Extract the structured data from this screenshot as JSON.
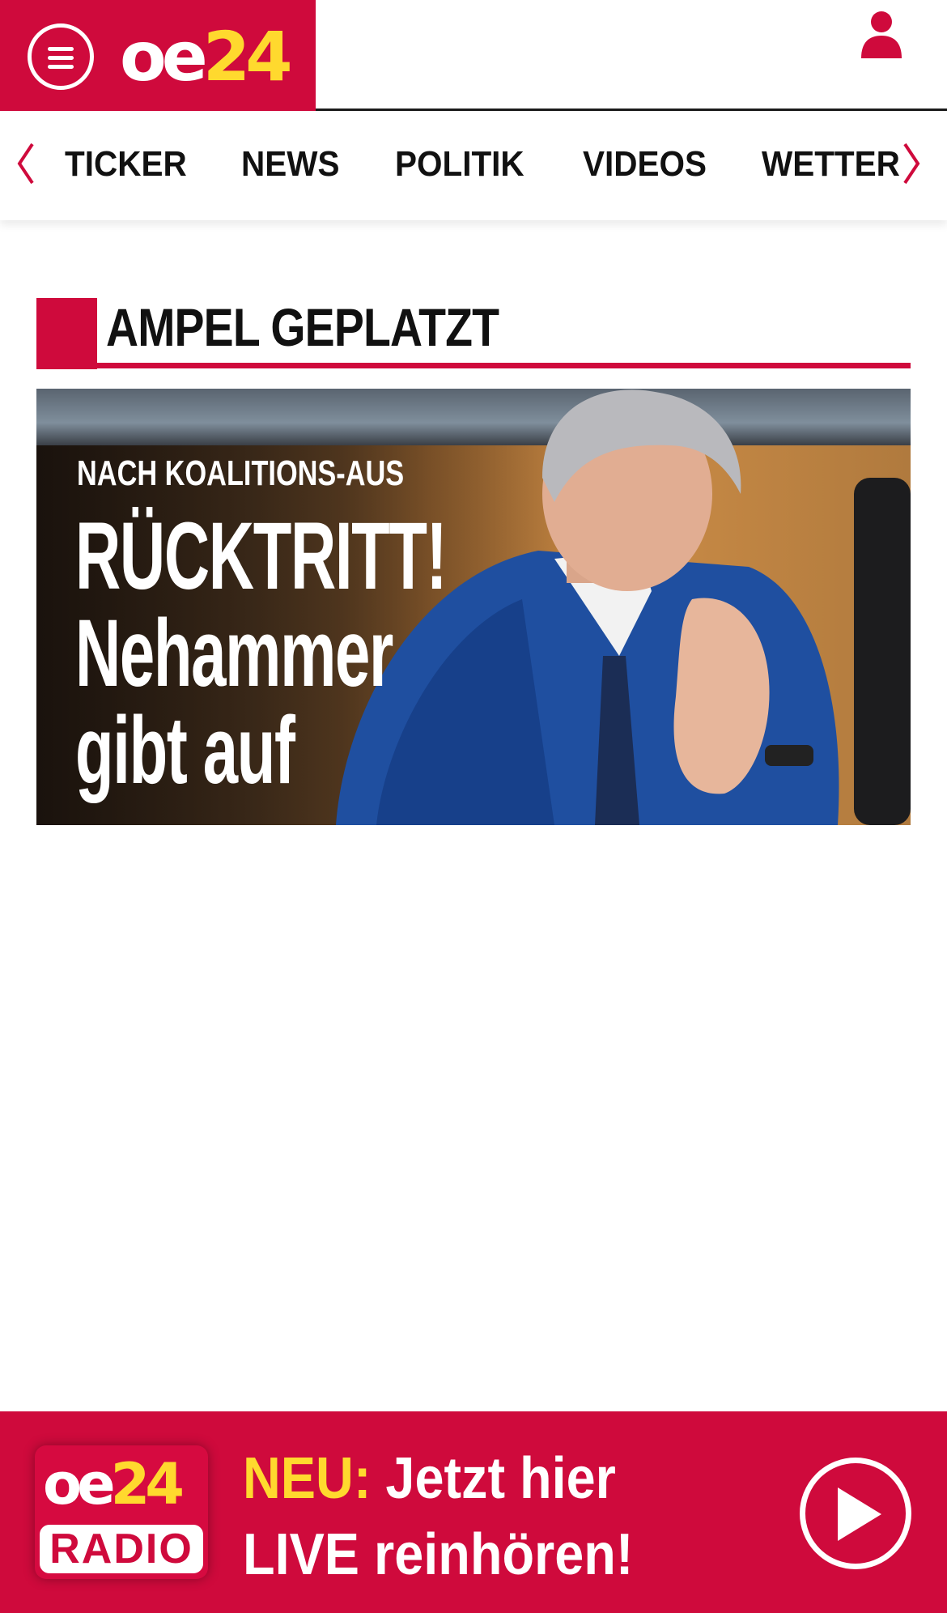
{
  "header": {
    "logo": {
      "part1": "oe",
      "part2": "24"
    },
    "menu_icon": "hamburger-menu-icon",
    "user_icon": "user-icon"
  },
  "nav": {
    "items": [
      "TICKER",
      "NEWS",
      "POLITIK",
      "VIDEOS",
      "WETTER"
    ],
    "prev_icon": "chevron-left-icon",
    "next_icon": "chevron-right-icon"
  },
  "section": {
    "title": "AMPEL GEPLATZT"
  },
  "hero": {
    "kicker": "NACH KOALITIONS-AUS",
    "line1": "RÜCKTRITT!",
    "line2": "Nehammer",
    "line3": "gibt auf"
  },
  "radio_banner": {
    "logo_top_part1": "oe",
    "logo_top_part2": "24",
    "logo_bottom": "RADIO",
    "highlight": "NEU:",
    "line1_rest": " Jetzt hier",
    "line2": "LIVE reinhören!",
    "play_icon": "play-icon"
  },
  "colors": {
    "brand_red": "#cf0a3c",
    "brand_yellow": "#ffd92e",
    "text_dark": "#111111"
  }
}
